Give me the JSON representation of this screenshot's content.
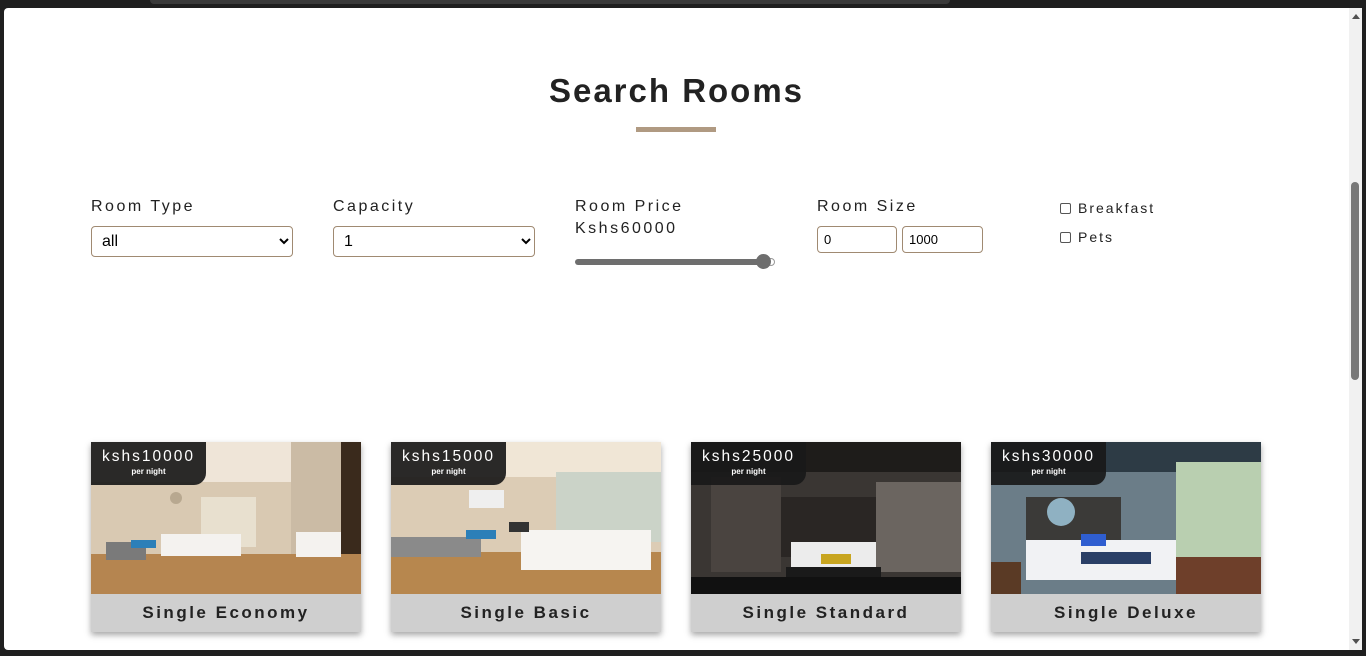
{
  "page": {
    "title": "Search Rooms"
  },
  "filters": {
    "room_type": {
      "label": "Room Type",
      "selected": "all"
    },
    "capacity": {
      "label": "Capacity",
      "selected": "1"
    },
    "room_price": {
      "label": "Room Price",
      "value_text": "Kshs60000",
      "slider_fraction": 0.96
    },
    "room_size": {
      "label": "Room Size",
      "min": "0",
      "max": "1000"
    },
    "breakfast": {
      "label": "Breakfast",
      "checked": false
    },
    "pets": {
      "label": "Pets",
      "checked": false
    }
  },
  "rooms": [
    {
      "price": "kshs10000",
      "per_night": "per night",
      "name": "Single Economy"
    },
    {
      "price": "kshs15000",
      "per_night": "per night",
      "name": "Single Basic"
    },
    {
      "price": "kshs25000",
      "per_night": "per night",
      "name": "Single Standard"
    },
    {
      "price": "kshs30000",
      "per_night": "per night",
      "name": "Single Deluxe"
    }
  ],
  "colors": {
    "accent_underline": "#b09a82",
    "badge_bg": "#191919",
    "card_name_bg": "#cfcfcf"
  }
}
